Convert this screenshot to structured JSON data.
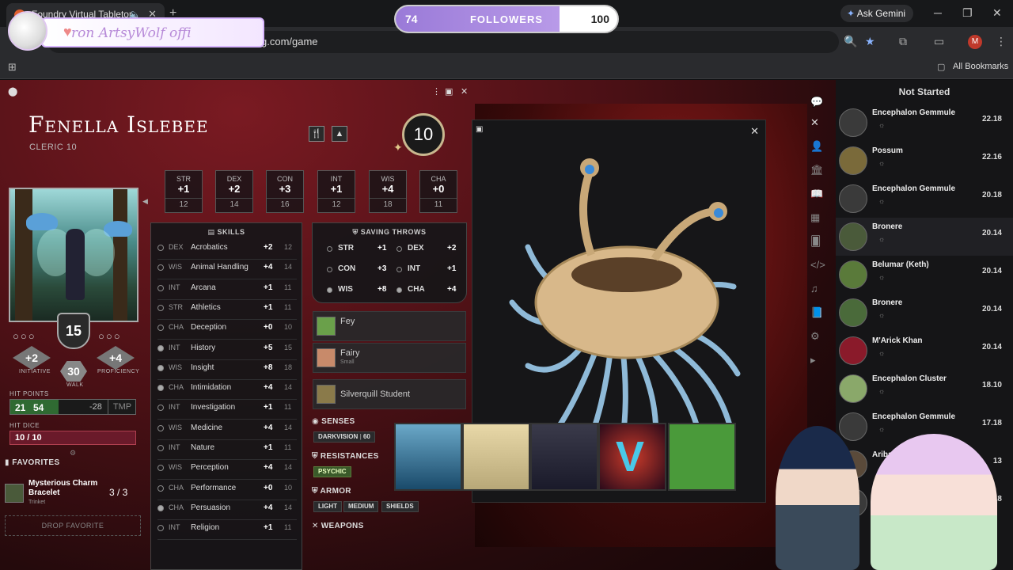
{
  "browser": {
    "tab_title": "Foundry Virtual Tabletop",
    "url_fragment": "g.com/game",
    "gemini_label": "Ask Gemini",
    "profile_initial": "M",
    "bookmarks_label": "All Bookmarks"
  },
  "stream": {
    "banner_text": "ron ArtsyWolf offi",
    "followers_current": "74",
    "followers_label": "FOLLOWERS",
    "followers_goal": "100",
    "followers_progress": 0.74
  },
  "character": {
    "name": "Fenella Islebee",
    "class": "CLERIC 10",
    "level": "10",
    "abilities": [
      {
        "name": "STR",
        "mod": "+1",
        "score": "12"
      },
      {
        "name": "DEX",
        "mod": "+2",
        "score": "14"
      },
      {
        "name": "CON",
        "mod": "+3",
        "score": "16"
      },
      {
        "name": "INT",
        "mod": "+1",
        "score": "12"
      },
      {
        "name": "WIS",
        "mod": "+4",
        "score": "18"
      },
      {
        "name": "CHA",
        "mod": "+0",
        "score": "11"
      }
    ],
    "ac": "15",
    "initiative": "+2",
    "initiative_label": "INITIATIVE",
    "proficiency": "+4",
    "proficiency_label": "PROFICIENCY",
    "walk": "30",
    "walk_label": "WALK",
    "hp_label": "HIT POINTS",
    "hp_current": "21",
    "hp_max": "54",
    "hp_fraction": 0.389,
    "hp_delta": "-28",
    "hp_tmp": "TMP",
    "hit_dice_label": "HIT DICE",
    "hit_dice": "10 / 10",
    "favorites_label": "FAVORITES",
    "favorites": [
      {
        "name": "Mysterious Charm Bracelet",
        "type": "Trinket",
        "qty": "3 / 3"
      }
    ],
    "drop_favorite": "DROP FAVORITE"
  },
  "skills": {
    "header": "SKILLS",
    "rows": [
      {
        "ab": "DEX",
        "name": "Acrobatics",
        "mod": "+2",
        "pass": "12",
        "prof": false
      },
      {
        "ab": "WIS",
        "name": "Animal Handling",
        "mod": "+4",
        "pass": "14",
        "prof": false
      },
      {
        "ab": "INT",
        "name": "Arcana",
        "mod": "+1",
        "pass": "11",
        "prof": false
      },
      {
        "ab": "STR",
        "name": "Athletics",
        "mod": "+1",
        "pass": "11",
        "prof": false
      },
      {
        "ab": "CHA",
        "name": "Deception",
        "mod": "+0",
        "pass": "10",
        "prof": false
      },
      {
        "ab": "INT",
        "name": "History",
        "mod": "+5",
        "pass": "15",
        "prof": true
      },
      {
        "ab": "WIS",
        "name": "Insight",
        "mod": "+8",
        "pass": "18",
        "prof": true
      },
      {
        "ab": "CHA",
        "name": "Intimidation",
        "mod": "+4",
        "pass": "14",
        "prof": true
      },
      {
        "ab": "INT",
        "name": "Investigation",
        "mod": "+1",
        "pass": "11",
        "prof": false
      },
      {
        "ab": "WIS",
        "name": "Medicine",
        "mod": "+4",
        "pass": "14",
        "prof": false
      },
      {
        "ab": "INT",
        "name": "Nature",
        "mod": "+1",
        "pass": "11",
        "prof": false
      },
      {
        "ab": "WIS",
        "name": "Perception",
        "mod": "+4",
        "pass": "14",
        "prof": false
      },
      {
        "ab": "CHA",
        "name": "Performance",
        "mod": "+0",
        "pass": "10",
        "prof": false
      },
      {
        "ab": "CHA",
        "name": "Persuasion",
        "mod": "+4",
        "pass": "14",
        "prof": true
      },
      {
        "ab": "INT",
        "name": "Religion",
        "mod": "+1",
        "pass": "11",
        "prof": false
      }
    ]
  },
  "saves": {
    "header": "SAVING THROWS",
    "rows": [
      {
        "name": "STR",
        "mod": "+1",
        "prof": false
      },
      {
        "name": "DEX",
        "mod": "+2",
        "prof": false
      },
      {
        "name": "CON",
        "mod": "+3",
        "prof": false
      },
      {
        "name": "INT",
        "mod": "+1",
        "prof": false
      },
      {
        "name": "WIS",
        "mod": "+8",
        "prof": true
      },
      {
        "name": "CHA",
        "mod": "+4",
        "prof": true
      }
    ]
  },
  "features": [
    {
      "name": "Fey",
      "sub": ""
    },
    {
      "name": "Fairy",
      "sub": "Small"
    },
    {
      "name": "Silverquill Student",
      "sub": ""
    }
  ],
  "senses": {
    "label": "SENSES",
    "chip": "DARKVISION",
    "value": "60"
  },
  "resistances": {
    "label": "RESISTANCES",
    "chip": "PSYCHIC"
  },
  "armor": {
    "label": "ARMOR",
    "chips": [
      "LIGHT",
      "MEDIUM",
      "SHIELDS"
    ]
  },
  "weapons": {
    "label": "WEAPONS"
  },
  "tracker": {
    "header": "Not Started",
    "rows": [
      {
        "name": "Encephalon Gemmule",
        "init": "22.18"
      },
      {
        "name": "Possum",
        "init": "22.16"
      },
      {
        "name": "Encephalon Gemmule",
        "init": "20.18"
      },
      {
        "name": "Bronere",
        "init": "20.14"
      },
      {
        "name": "Belumar (Keth)",
        "init": "20.14"
      },
      {
        "name": "Bronere",
        "init": "20.14"
      },
      {
        "name": "M'Arick Khan",
        "init": "20.14"
      },
      {
        "name": "Encephalon Cluster",
        "init": "18.10"
      },
      {
        "name": "Encephalon Gemmule",
        "init": "17.18"
      },
      {
        "name": "Aribald",
        "init": "13"
      },
      {
        "name": "Ence",
        "init": "9.18"
      }
    ]
  },
  "colors": {
    "accent": "#9a7ad8",
    "hp_green": "#2f6a32",
    "hit_dice": "#6a1a2a",
    "psychic": "#3a5a2a"
  }
}
